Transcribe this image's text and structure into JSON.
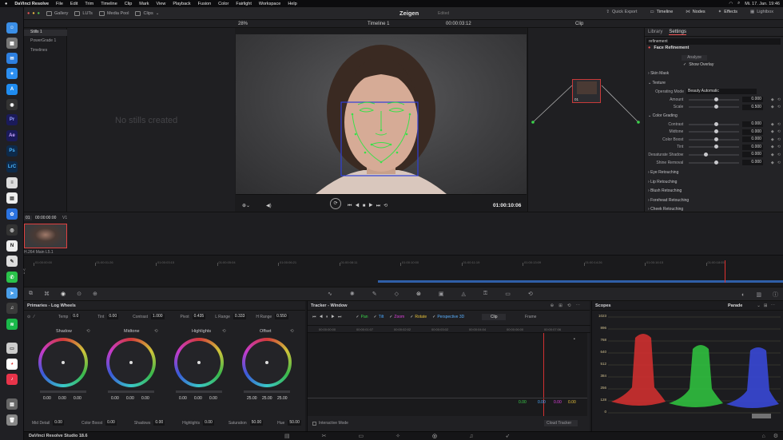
{
  "menubar": {
    "app": "DaVinci Resolve",
    "items": [
      "File",
      "Edit",
      "Trim",
      "Timeline",
      "Clip",
      "Mark",
      "View",
      "Playback",
      "Fusion",
      "Color",
      "Fairlight",
      "Workspace",
      "Help"
    ],
    "datetime": "Mi. 17. Jan.  19:46"
  },
  "topbar": {
    "gallery": "Gallery",
    "luts": "LUTs",
    "media_pool": "Media Pool",
    "clips": "Clips",
    "project_title": "Zeigen",
    "edited": "Edited",
    "quick_export": "Quick Export",
    "timeline": "Timeline",
    "nodes": "Nodes",
    "effects": "Effects",
    "lightbox": "Lightbox"
  },
  "bar2": {
    "zoom": "28%",
    "timeline_name": "Timeline 1",
    "timecode": "00:00:03:12",
    "clip_mode": "Clip"
  },
  "stills": {
    "items": [
      "Stills 1",
      "PowerGrade 1",
      "Timelines"
    ],
    "empty_text": "No stills created"
  },
  "viewer": {
    "timecode": "01:00:10:06"
  },
  "node": {
    "label": "01"
  },
  "inspector": {
    "tabs": [
      "Library",
      "Settings"
    ],
    "search_value": "refinement",
    "fx_name": "Face Refinement",
    "analyze": "Analyze",
    "show_overlay": "Show Overlay",
    "sections": {
      "skin_mask": "Skin Mask",
      "texture": "Texture",
      "color_grading": "Color Grading",
      "eye": "Eye Retouching",
      "lip": "Lip Retouching",
      "blush": "Blush Retouching",
      "forehead": "Forehead Retouching",
      "cheek": "Cheek Retouching"
    },
    "operating_mode_label": "Operating Mode",
    "operating_mode": "Beauty Automatic",
    "texture_params": [
      {
        "label": "Amount",
        "value": "0.000",
        "pos": 0.5
      },
      {
        "label": "Scale",
        "value": "0.500",
        "pos": 0.5
      }
    ],
    "color_params": [
      {
        "label": "Contrast",
        "value": "0.000",
        "pos": 0.5
      },
      {
        "label": "Midtone",
        "value": "0.000",
        "pos": 0.5
      },
      {
        "label": "Color Boost",
        "value": "0.000",
        "pos": 0.5
      },
      {
        "label": "Tint",
        "value": "0.000",
        "pos": 0.5
      },
      {
        "label": "Desaturate Shadow",
        "value": "0.000",
        "pos": 0.3
      },
      {
        "label": "Shine Removal",
        "value": "0.000",
        "pos": 0.5
      }
    ]
  },
  "clipstrip": {
    "index": "01",
    "timecode": "00:00:00:00",
    "track": "V1",
    "codec": "H.264 Main L5.1"
  },
  "ruler": {
    "ticks": [
      "01:00:00:00",
      "01:00:01:26",
      "01:00:03:15",
      "01:00:05:04",
      "01:00:06:21",
      "01:00:08:11",
      "01:00:10:00",
      "01:00:11:19",
      "01:00:13:09",
      "01:00:14:26",
      "01:00:16:15",
      "01:00:18:05"
    ]
  },
  "wheels": {
    "title": "Primaries - Log Wheels",
    "temp_label": "Temp",
    "temp": "0.0",
    "tint_label": "Tint",
    "tint": "0.00",
    "contrast_label": "Contrast",
    "contrast": "1.000",
    "pivot_label": "Pivot",
    "pivot": "0.435",
    "lrange_label": "L Range",
    "lrange": "0.333",
    "hrange_label": "H Range",
    "hrange": "0.550",
    "names": [
      "Shadow",
      "Midtone",
      "Highlights",
      "Offset"
    ],
    "values": [
      [
        "0.00",
        "0.00",
        "0.00"
      ],
      [
        "0.00",
        "0.00",
        "0.00"
      ],
      [
        "0.00",
        "0.00",
        "0.00"
      ],
      [
        "25.00",
        "25.00",
        "25.00"
      ]
    ],
    "md_label": "Mid Detail",
    "md": "0.00",
    "cb_label": "Color Boost",
    "cb": "0.00",
    "sh_label": "Shadows",
    "sh": "0.00",
    "hl_label": "Highlights",
    "hl": "0.00",
    "sat_label": "Saturation",
    "sat": "50.00",
    "hue_label": "Hue",
    "hue": "50.00"
  },
  "tracker": {
    "title": "Tracker - Window",
    "checks": [
      "Pan",
      "Tilt",
      "Zoom",
      "Rotate",
      "Perspective 3D"
    ],
    "clip": "Clip",
    "frame": "Frame",
    "ticks": [
      "00:00:00:00",
      "00:00:01:07",
      "00:00:02:02",
      "00:00:03:02",
      "00:00:04:04",
      "00:00:06:00",
      "00:00:07:06"
    ],
    "readout": [
      "0.00",
      "0.00",
      "0.00",
      "0.00"
    ],
    "interactive": "Interactive Mode",
    "cloud": "Cloud Tracker",
    "check_colors": [
      "#3ad24a",
      "#4aa8ff",
      "#e040e0",
      "#e8c23a",
      "#5ab0ff"
    ]
  },
  "scopes": {
    "title": "Scopes",
    "mode": "Parade",
    "scale": [
      "1023",
      "896",
      "768",
      "640",
      "512",
      "384",
      "256",
      "128",
      "0"
    ]
  },
  "bottom": {
    "app": "DaVinci Resolve Studio 18.6"
  }
}
